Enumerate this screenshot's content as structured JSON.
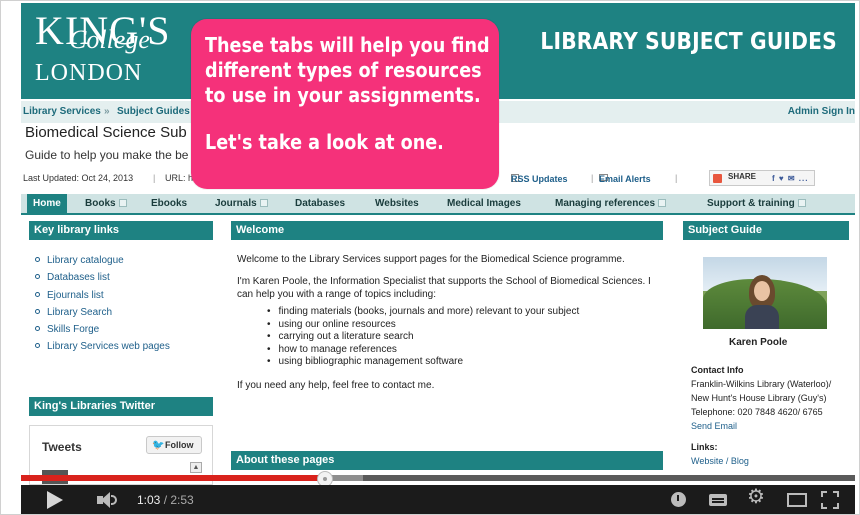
{
  "header": {
    "logo": {
      "line1": "KING'S",
      "line2": "College",
      "line3": "LONDON"
    },
    "title": "LIBRARY SUBJECT GUIDES"
  },
  "breadcrumb": {
    "item1": "Library Services",
    "sep": "»",
    "item2": "Subject Guides",
    "admin": "Admin Sign In"
  },
  "guide": {
    "title": "Biomedical Science Sub",
    "description": "Guide to help you make the be"
  },
  "meta": {
    "updated": "Last Updated: Oct 24, 2013",
    "url_label": "URL: h",
    "rss": "RSS Updates",
    "email": "Email Alerts",
    "share": "SHARE",
    "share_icons": "f ♥ ✉ ..."
  },
  "tabs": [
    {
      "label": "Home",
      "dropdown": false
    },
    {
      "label": "Books",
      "dropdown": true
    },
    {
      "label": "Ebooks",
      "dropdown": false
    },
    {
      "label": "Journals",
      "dropdown": true
    },
    {
      "label": "Databases",
      "dropdown": false
    },
    {
      "label": "Websites",
      "dropdown": false
    },
    {
      "label": "Medical Images",
      "dropdown": false
    },
    {
      "label": "Managing references",
      "dropdown": true
    },
    {
      "label": "Support & training",
      "dropdown": true
    }
  ],
  "key_links": {
    "heading": "Key library links",
    "items": [
      "Library catalogue",
      "Databases list",
      "Ejournals list",
      "Library Search",
      "Skills Forge",
      "Library Services web pages"
    ]
  },
  "twitter": {
    "heading": "King's Libraries Twitter",
    "tweets_title": "Tweets",
    "follow": "Follow",
    "scroll": "▲"
  },
  "welcome": {
    "heading": "Welcome",
    "p1": "Welcome to the Library Services support pages for the Biomedical Science programme.",
    "p2": "I'm Karen Poole, the Information Specialist that supports the School of Biomedical Sciences. I can help you with a range of topics including:",
    "list": [
      "finding materials (books, journals and more) relevant to your subject",
      "using our online resources",
      "carrying out a literature search",
      "how to manage references",
      "using bibliographic management software"
    ],
    "p3": "If you need any help, feel free to contact me."
  },
  "about": {
    "heading": "About these pages"
  },
  "subject_guide": {
    "heading": "Subject Guide",
    "name": "Karen Poole",
    "contact_heading": "Contact Info",
    "contact_lines": [
      "Franklin-Wilkins Library (Waterloo)/",
      "New Hunt's House Library (Guy's)",
      "Telephone: 020 7848 4620/ 6765"
    ],
    "send_email": "Send Email",
    "links_heading": "Links:",
    "links_value": "Website / Blog"
  },
  "callout": {
    "line1": "These tabs will help you find",
    "line2": "different types of resources",
    "line3": "to use in your assignments.",
    "line4": "Let's take a look at one."
  },
  "player": {
    "current_time": "1:03",
    "duration": "/ 2:53",
    "progress_fraction": 0.364,
    "buffered_fraction": 0.41
  },
  "colors": {
    "teal": "#1e8282",
    "callout_pink": "#f5317a",
    "progress_red": "#d9221c"
  }
}
